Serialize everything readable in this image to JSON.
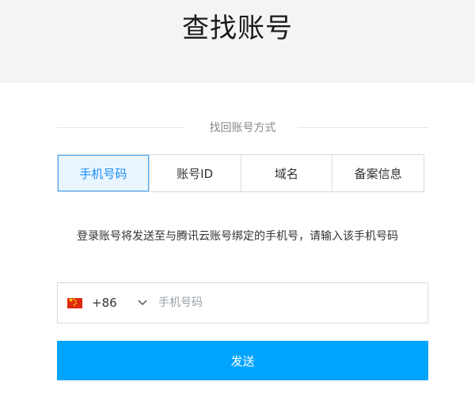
{
  "header": {
    "title": "查找账号"
  },
  "method_section": {
    "label": "找回账号方式"
  },
  "tabs": [
    {
      "label": "手机号码",
      "active": true
    },
    {
      "label": "账号ID",
      "active": false
    },
    {
      "label": "域名",
      "active": false
    },
    {
      "label": "备案信息",
      "active": false
    }
  ],
  "info": {
    "text": "登录账号将发送至与腾讯云账号绑定的手机号，请输入该手机号码"
  },
  "phone_input": {
    "country_code": "+86",
    "flag_icon": "china-flag-icon",
    "placeholder": "手机号码",
    "value": ""
  },
  "send_button": {
    "label": "发送"
  },
  "colors": {
    "accent": "#00a4ff",
    "active_tab_bg": "#e9f5fe",
    "active_tab_text": "#1d8df5",
    "header_bg": "#f3f4f6"
  }
}
